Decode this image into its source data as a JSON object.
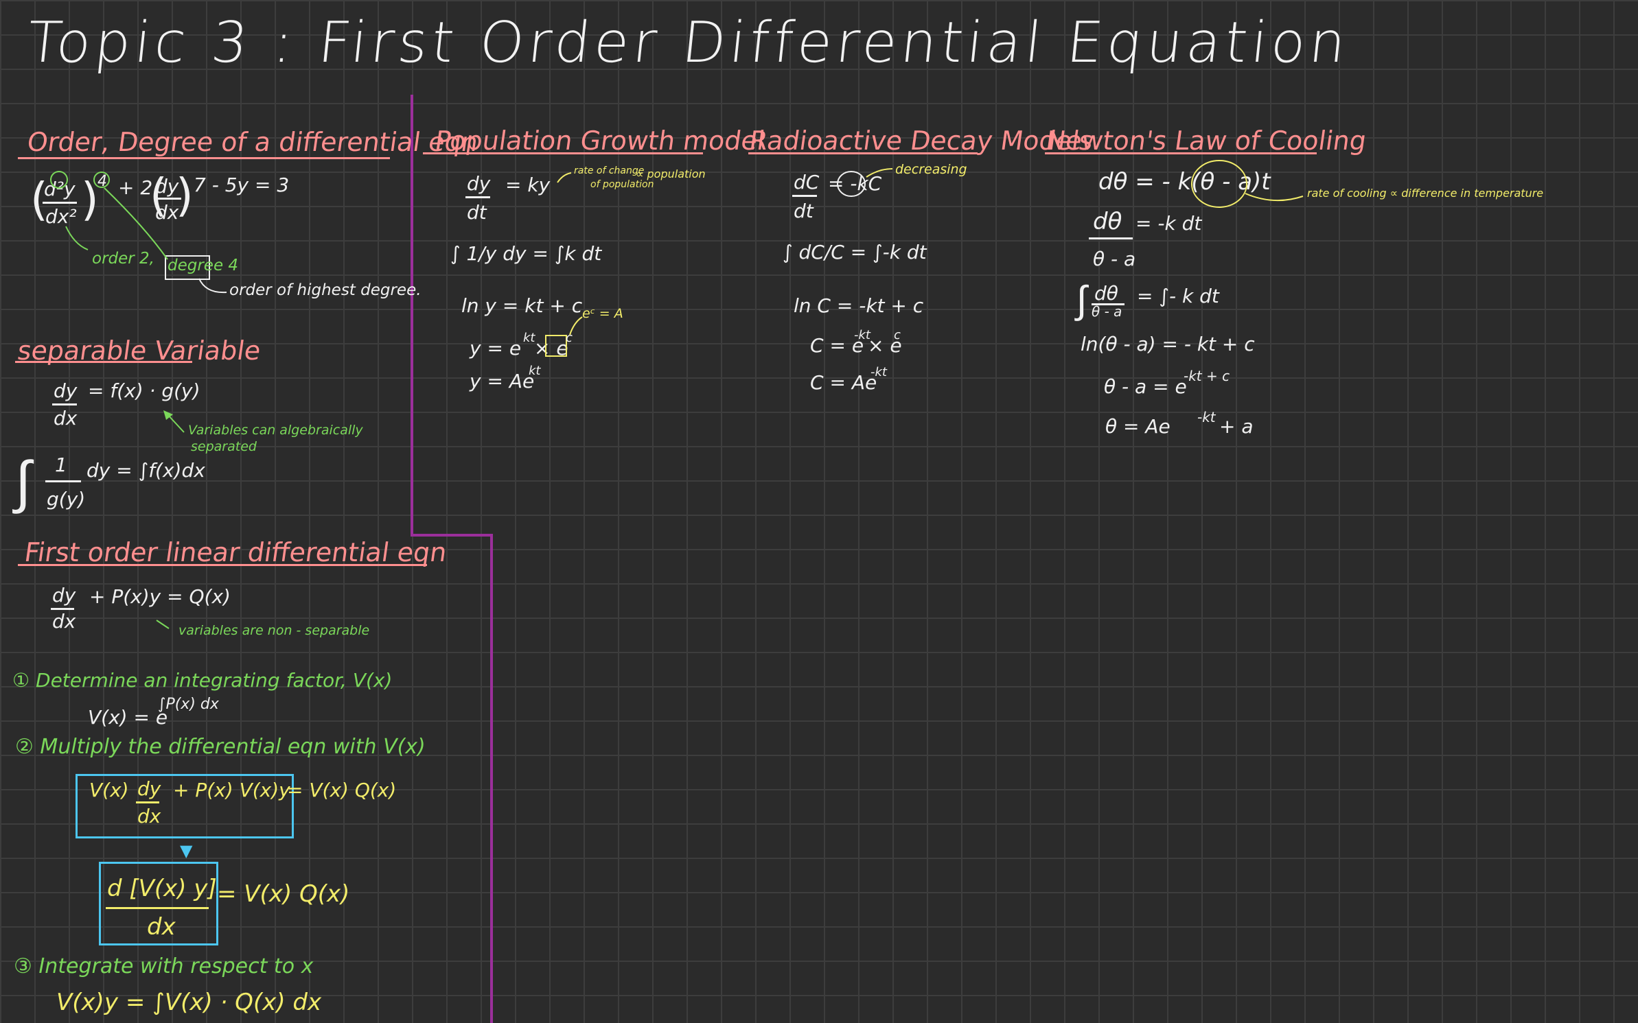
{
  "title": "Topic 3 : First Order Differential Equation",
  "order_degree": {
    "heading": "Order, Degree of a differential eqn",
    "eq_lhs_num": "d²y",
    "eq_lhs_den": "dx²",
    "eq_power": "4",
    "eq_mid": "+ 2",
    "eq_dy": "dy",
    "eq_dx": "dx",
    "eq_tail": "7 - 5y = 3",
    "order_note": "order 2,",
    "degree_note": "degree 4",
    "highest_note": "order of highest degree."
  },
  "separable": {
    "heading": "separable Variable",
    "dy": "dy",
    "dx": "dx",
    "rhs": "=  f(x) · g(y)",
    "note": "Variables can algebraically",
    "note2": "separated",
    "int_one": "1",
    "int_gy": "g(y)",
    "int_rest": "dy = ∫f(x)dx"
  },
  "linear": {
    "heading": "First order linear differential eqn",
    "dy": "dy",
    "dx": "dx",
    "rhs": "+ P(x)y  = Q(x)",
    "note": "variables are non - separable",
    "step1": "① Determine an integrating factor, V(x)",
    "v_def": "V(x) = e",
    "v_exp": "∫P(x) dx",
    "step2": "② Multiply the differential eqn with V(x)",
    "box1_left": "V(x)",
    "box1_dy": "dy",
    "box1_dx": "dx",
    "box1_mid": "+  P(x) V(x)y",
    "box1_rhs": "=  V(x) Q(x)",
    "box2_num": "d [V(x) y]",
    "box2_den": "dx",
    "box2_rhs": "=  V(x) Q(x)",
    "step3": "③ Integrate with respect to x",
    "final": "V(x)y = ∫V(x) · Q(x) dx"
  },
  "population": {
    "heading": "Population Growth model",
    "dy": "dy",
    "dt": "dt",
    "rhs": "= ky",
    "note1": "rate of change",
    "note1b": "of population",
    "note2": "∝ population",
    "int_line": "∫ 1/y dy = ∫k dt",
    "ln_line": "ln y  = kt + c",
    "ec_note": "eᶜ = A",
    "y1": "y = e",
    "y1_exp": "kt",
    "y1_x": "× e",
    "y1_c": "c",
    "y2": "y = Ae",
    "y2_exp": "kt"
  },
  "decay": {
    "heading": "Radioactive Decay Models",
    "dc": "dC",
    "dt": "dt",
    "rhs": "= -kC",
    "note": "decreasing",
    "int_line": "∫ dC/C = ∫-k dt",
    "ln_line": "ln C = -kt + c",
    "c1": "C = e",
    "c1_exp": "-kt",
    "c1_tail": "× e",
    "c1_c": "c",
    "c2": "C = Ae",
    "c2_exp": "-kt"
  },
  "newton": {
    "heading": "Newton's Law of Cooling",
    "l1": "dθ = - k(θ - a)t",
    "note": "rate of cooling ∝ difference in temperature",
    "l2_num": "dθ",
    "l2_den": "θ - a",
    "l2_rhs": "=   -k dt",
    "l3_num": "dθ",
    "l3_den": "θ - a",
    "l3_rhs": "=  ∫- k dt",
    "l4": "ln(θ - a) = - kt + c",
    "l5": "θ - a  =  e",
    "l5_exp": "-kt + c",
    "l6": "θ    =  Ae",
    "l6_exp": "-kt",
    "l6_tail": "+ a"
  },
  "colors": {
    "background": "#2b2b2b",
    "grid": "#3d3d3d",
    "heading": "#ff8f8f",
    "note": "#7bd85a",
    "highlight": "#f2ec6a",
    "box": "#4cc6f0",
    "divider": "#9b2f9b"
  }
}
